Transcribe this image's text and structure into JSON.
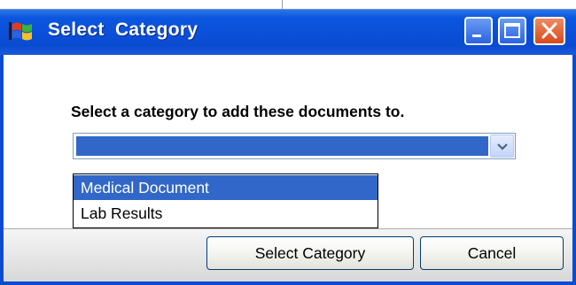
{
  "dialog": {
    "title": "Select  Category",
    "prompt": "Select a category to add these documents to.",
    "combo": {
      "selected_value": ""
    },
    "dropdown": {
      "options": [
        "Medical Document",
        "Lab Results"
      ],
      "highlighted": "Medical Document"
    },
    "buttons": {
      "select_label": "Select Category",
      "cancel_label": "Cancel"
    }
  },
  "icons": {
    "app": "windows-flag-icon",
    "minimize": "minimize-icon",
    "maximize": "maximize-icon",
    "close": "close-icon",
    "dropdown_arrow": "chevron-down-icon"
  },
  "colors": {
    "titlebar": "#0a4bd2",
    "selection": "#3167c8",
    "close_button": "#d54a1a"
  }
}
